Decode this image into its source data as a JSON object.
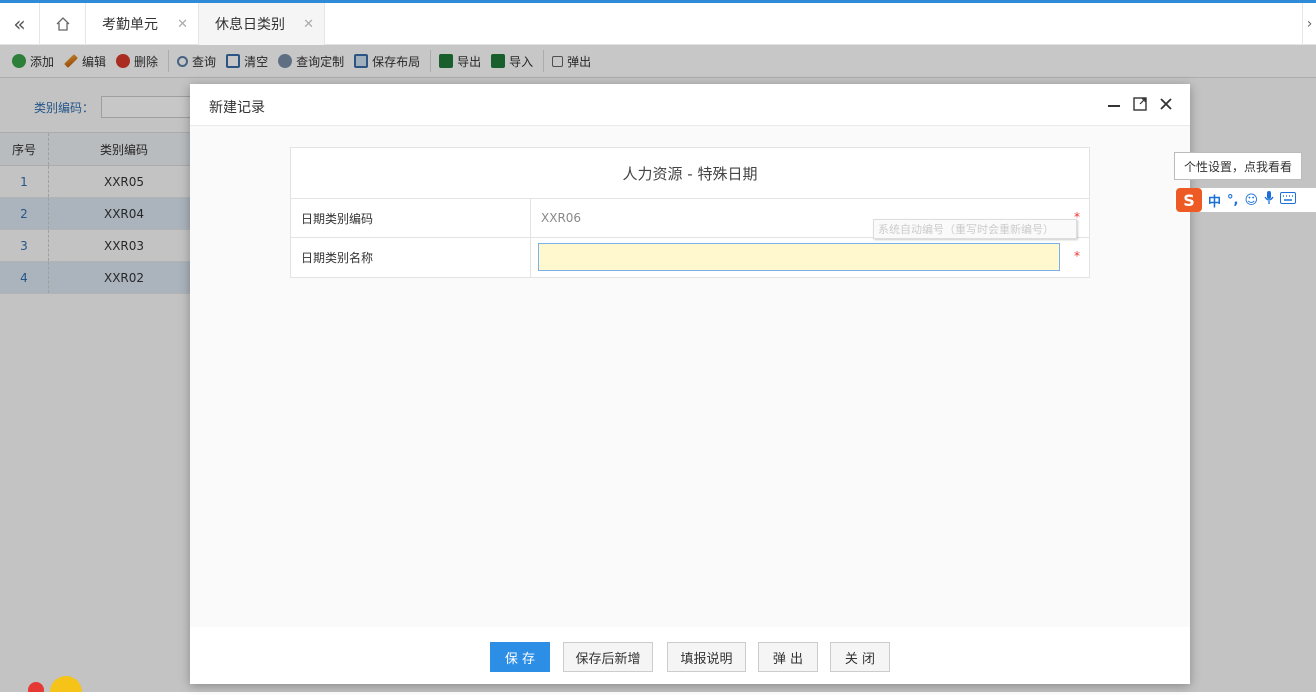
{
  "tabs": {
    "items": [
      {
        "label": "考勤单元"
      },
      {
        "label": "休息日类别"
      }
    ]
  },
  "toolbar": {
    "add": "添加",
    "edit": "编辑",
    "delete": "删除",
    "query": "查询",
    "clear": "清空",
    "custom_query": "查询定制",
    "save_layout": "保存布局",
    "export": "导出",
    "import": "导入",
    "popup": "弹出"
  },
  "search": {
    "label": "类别编码："
  },
  "grid": {
    "headers": [
      "序号",
      "类别编码"
    ],
    "rows": [
      [
        "1",
        "XXR05"
      ],
      [
        "2",
        "XXR04"
      ],
      [
        "3",
        "XXR03"
      ],
      [
        "4",
        "XXR02"
      ]
    ]
  },
  "modal": {
    "title": "新建记录",
    "form_title": "人力资源 - 特殊日期",
    "fields": [
      {
        "label": "日期类别编码",
        "value": "XXR06",
        "hint": "系统自动编号（重写时会重新编号）",
        "required": "*"
      },
      {
        "label": "日期类别名称",
        "value": "",
        "required": "*"
      }
    ],
    "buttons": {
      "save": "保 存",
      "save_new": "保存后新增",
      "instructions": "填报说明",
      "popup": "弹 出",
      "close": "关 闭"
    }
  },
  "ime": {
    "tooltip": "个性设置，点我看看",
    "mode": "中",
    "punct": "°,"
  },
  "colors": {
    "accent": "#2f8bd8",
    "primary_button": "#2d8ee6",
    "focused_input_bg": "#fff8cf",
    "required": "#e33333",
    "ime_logo": "#ee5a24"
  }
}
